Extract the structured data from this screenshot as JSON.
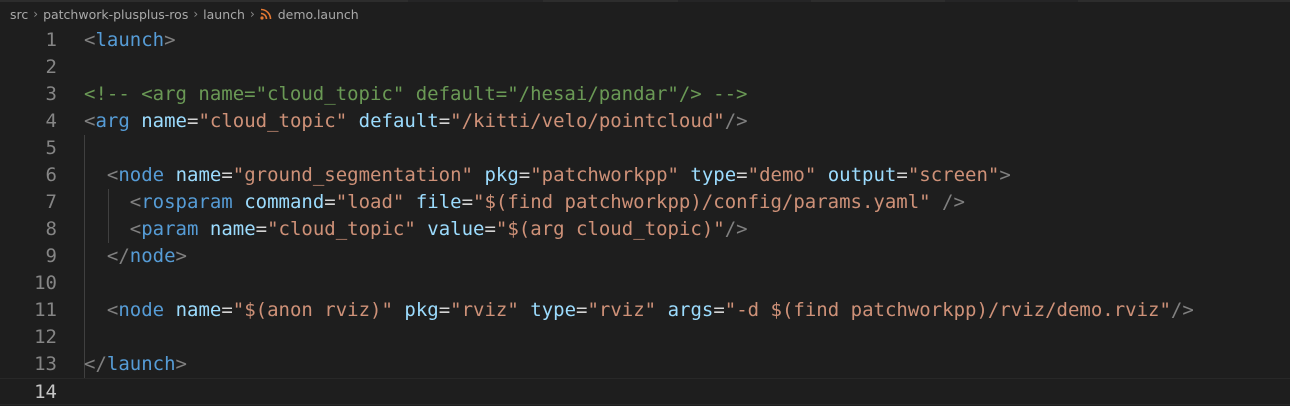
{
  "breadcrumb": {
    "items": [
      "src",
      "patchwork-plusplus-ros",
      "launch",
      "demo.launch"
    ],
    "file_icon": "rss-icon"
  },
  "editor": {
    "current_line": 14,
    "lines": [
      {
        "n": "1",
        "tokens": [
          [
            "b",
            "<"
          ],
          [
            "tag",
            "launch"
          ],
          [
            "b",
            ">"
          ]
        ]
      },
      {
        "n": "2",
        "tokens": []
      },
      {
        "n": "3",
        "tokens": [
          [
            "c",
            "<!-- <arg name=\"cloud_topic\" default=\"/hesai/pandar\"/> -->"
          ]
        ]
      },
      {
        "n": "4",
        "tokens": [
          [
            "b",
            "<"
          ],
          [
            "tag",
            "arg"
          ],
          [
            "t",
            " "
          ],
          [
            "attr",
            "name"
          ],
          [
            "eq",
            "="
          ],
          [
            "str",
            "\"cloud_topic\""
          ],
          [
            "t",
            " "
          ],
          [
            "attr",
            "default"
          ],
          [
            "eq",
            "="
          ],
          [
            "str",
            "\"/kitti/velo/pointcloud\""
          ],
          [
            "b",
            "/>"
          ]
        ]
      },
      {
        "n": "5",
        "tokens": []
      },
      {
        "n": "6",
        "tokens": [
          [
            "t",
            "  "
          ],
          [
            "b",
            "<"
          ],
          [
            "tag",
            "node"
          ],
          [
            "t",
            " "
          ],
          [
            "attr",
            "name"
          ],
          [
            "eq",
            "="
          ],
          [
            "str",
            "\"ground_segmentation\""
          ],
          [
            "t",
            " "
          ],
          [
            "attr",
            "pkg"
          ],
          [
            "eq",
            "="
          ],
          [
            "str",
            "\"patchworkpp\""
          ],
          [
            "t",
            " "
          ],
          [
            "attr",
            "type"
          ],
          [
            "eq",
            "="
          ],
          [
            "str",
            "\"demo\""
          ],
          [
            "t",
            " "
          ],
          [
            "attr",
            "output"
          ],
          [
            "eq",
            "="
          ],
          [
            "str",
            "\"screen\""
          ],
          [
            "b",
            ">"
          ]
        ]
      },
      {
        "n": "7",
        "tokens": [
          [
            "t",
            "    "
          ],
          [
            "b",
            "<"
          ],
          [
            "tag",
            "rosparam"
          ],
          [
            "t",
            " "
          ],
          [
            "attr",
            "command"
          ],
          [
            "eq",
            "="
          ],
          [
            "str",
            "\"load\""
          ],
          [
            "t",
            " "
          ],
          [
            "attr",
            "file"
          ],
          [
            "eq",
            "="
          ],
          [
            "str",
            "\"$(find patchworkpp)/config/params.yaml\""
          ],
          [
            "t",
            " "
          ],
          [
            "b",
            "/>"
          ]
        ]
      },
      {
        "n": "8",
        "tokens": [
          [
            "t",
            "    "
          ],
          [
            "b",
            "<"
          ],
          [
            "tag",
            "param"
          ],
          [
            "t",
            " "
          ],
          [
            "attr",
            "name"
          ],
          [
            "eq",
            "="
          ],
          [
            "str",
            "\"cloud_topic\""
          ],
          [
            "t",
            " "
          ],
          [
            "attr",
            "value"
          ],
          [
            "eq",
            "="
          ],
          [
            "str",
            "\"$(arg cloud_topic)\""
          ],
          [
            "b",
            "/>"
          ]
        ]
      },
      {
        "n": "9",
        "tokens": [
          [
            "t",
            "  "
          ],
          [
            "b",
            "</"
          ],
          [
            "tag",
            "node"
          ],
          [
            "b",
            ">"
          ]
        ]
      },
      {
        "n": "10",
        "tokens": []
      },
      {
        "n": "11",
        "tokens": [
          [
            "t",
            "  "
          ],
          [
            "b",
            "<"
          ],
          [
            "tag",
            "node"
          ],
          [
            "t",
            " "
          ],
          [
            "attr",
            "name"
          ],
          [
            "eq",
            "="
          ],
          [
            "str",
            "\"$(anon rviz)\""
          ],
          [
            "t",
            " "
          ],
          [
            "attr",
            "pkg"
          ],
          [
            "eq",
            "="
          ],
          [
            "str",
            "\"rviz\""
          ],
          [
            "t",
            " "
          ],
          [
            "attr",
            "type"
          ],
          [
            "eq",
            "="
          ],
          [
            "str",
            "\"rviz\""
          ],
          [
            "t",
            " "
          ],
          [
            "attr",
            "args"
          ],
          [
            "eq",
            "="
          ],
          [
            "str",
            "\"-d $(find patchworkpp)/rviz/demo.rviz\""
          ],
          [
            "b",
            "/>"
          ]
        ]
      },
      {
        "n": "12",
        "tokens": []
      },
      {
        "n": "13",
        "tokens": [
          [
            "b",
            "</"
          ],
          [
            "tag",
            "launch"
          ],
          [
            "b",
            ">"
          ]
        ]
      },
      {
        "n": "14",
        "tokens": []
      }
    ]
  },
  "colors": {
    "background": "#1e1e1e",
    "tag": "#569cd6",
    "attribute": "#9cdcfe",
    "string": "#ce9178",
    "comment": "#6a9955",
    "bracket": "#808080"
  }
}
